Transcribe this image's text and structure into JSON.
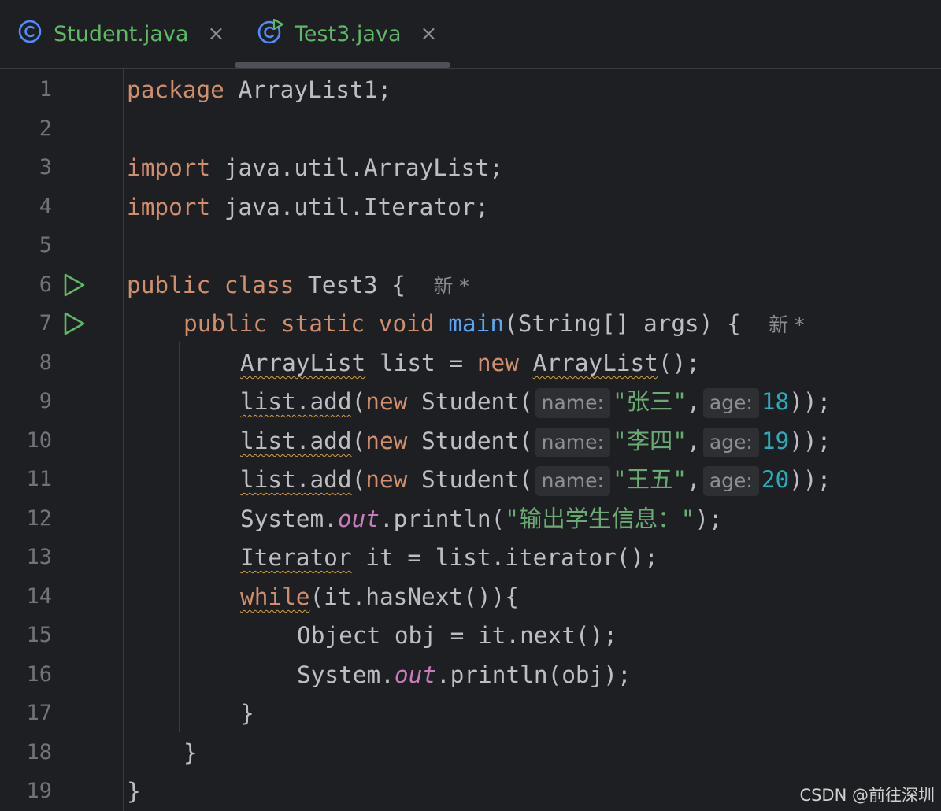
{
  "tabs": [
    {
      "label": "Student.java",
      "close": "×"
    },
    {
      "label": "Test3.java",
      "close": "×"
    }
  ],
  "colors": {
    "keyword": "#cf8e6d",
    "method": "#56a8f5",
    "string": "#6aab73",
    "number": "#2aacb8",
    "static_field": "#c77dbb",
    "text": "#bcbec4",
    "background": "#1e1f22"
  },
  "icons": {
    "class_file": "class-c-icon",
    "runnable_class": "run-class-c-icon",
    "run_gutter": "run-triangle-icon"
  },
  "gutter": {
    "line_numbers": [
      "1",
      "2",
      "3",
      "4",
      "5",
      "6",
      "7",
      "8",
      "9",
      "10",
      "11",
      "12",
      "13",
      "14",
      "15",
      "16",
      "17",
      "18",
      "19"
    ]
  },
  "code": {
    "l1": {
      "kw": "package",
      "rest": " ArrayList1;"
    },
    "l3": {
      "kw": "import",
      "rest": " java.util.ArrayList;"
    },
    "l4": {
      "kw": "import",
      "rest": " java.util.Iterator;"
    },
    "l6": {
      "kw1": "public",
      "kw2": "class",
      "name": " Test3 {",
      "hint": "新 *"
    },
    "l7": {
      "kw1": "public",
      "kw2": "static",
      "kw3": "void",
      "fn": "main",
      "rest": "(String[] args) {",
      "hint": "新 *"
    },
    "l8": {
      "type": "ArrayList",
      "mid": " list = ",
      "kw": "new",
      "type2": "ArrayList",
      "rest": "();"
    },
    "l9": {
      "a": "list.add",
      "b": "(",
      "kw": "new",
      "c": " Student(",
      "hint1": "name:",
      "str": "\"张三\"",
      "d": ",",
      "hint2": "age:",
      "num": "18",
      "e": "));"
    },
    "l10": {
      "a": "list.add",
      "b": "(",
      "kw": "new",
      "c": " Student(",
      "hint1": "name:",
      "str": "\"李四\"",
      "d": ",",
      "hint2": "age:",
      "num": "19",
      "e": "));"
    },
    "l11": {
      "a": "list.add",
      "b": "(",
      "kw": "new",
      "c": " Student(",
      "hint1": "name:",
      "str": "\"王五\"",
      "d": ",",
      "hint2": "age:",
      "num": "20",
      "e": "));"
    },
    "l12": {
      "a": "System.",
      "field": "out",
      "b": ".println(",
      "str": "\"输出学生信息：\"",
      "c": ");"
    },
    "l13": {
      "type": "Iterator",
      "rest": " it = list.iterator();"
    },
    "l14": {
      "kw": "while",
      "rest": "(it.hasNext()){"
    },
    "l15": {
      "text": "Object obj = it.next();"
    },
    "l16": {
      "a": "System.",
      "field": "out",
      "b": ".println(obj);"
    },
    "l17": {
      "text": "}"
    },
    "l18": {
      "text": "}"
    },
    "l19": {
      "text": "}"
    }
  },
  "watermark": "CSDN @前往深圳"
}
